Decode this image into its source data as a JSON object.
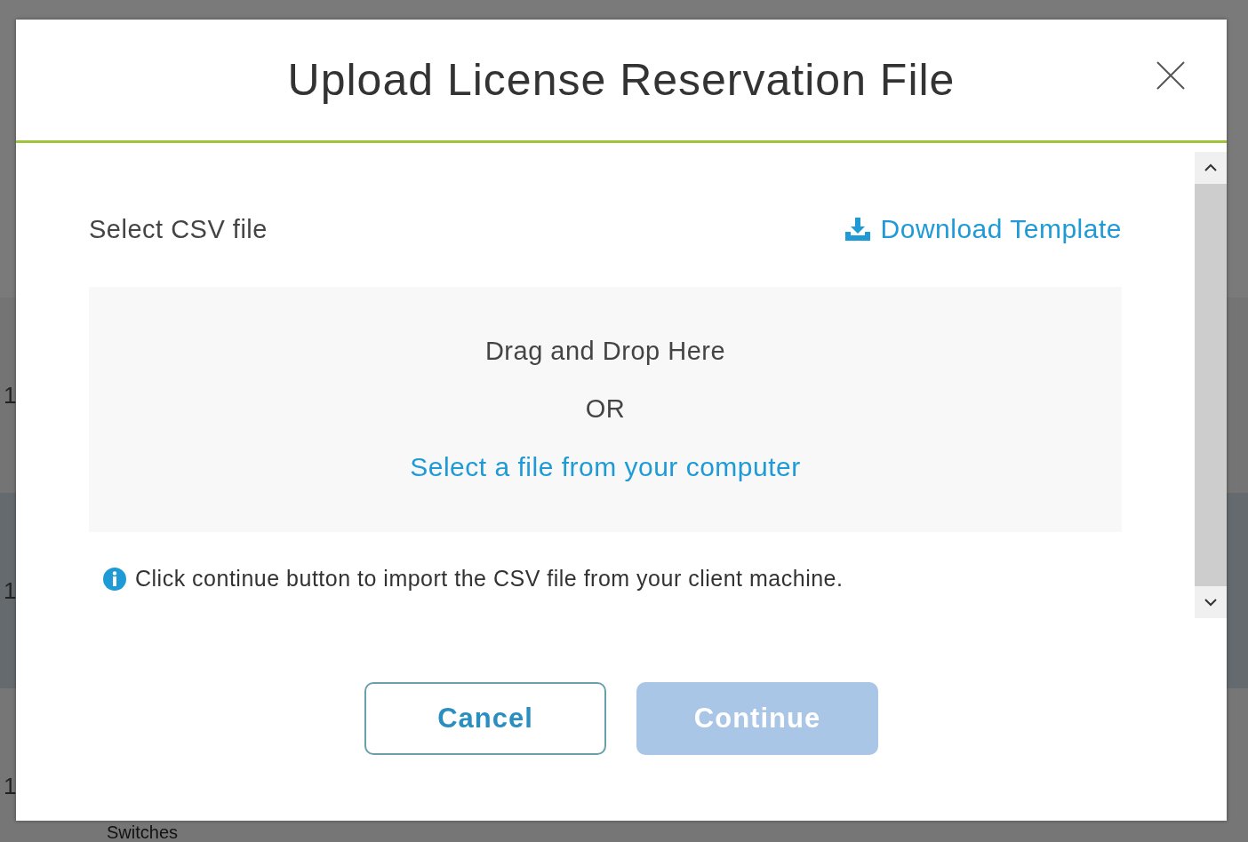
{
  "background": {
    "row_numbers": [
      "1",
      "1",
      "1"
    ],
    "bottom_label": "Switches"
  },
  "dialog": {
    "title": "Upload License Reservation File",
    "section_label": "Select CSV file",
    "download_link": "Download Template",
    "dropzone": {
      "heading": "Drag and Drop Here",
      "separator": "OR",
      "link": "Select a file from your computer"
    },
    "info": "Click continue button to import the CSV file from your client machine.",
    "buttons": [
      {
        "label": "Cancel",
        "kind": "secondary",
        "disabled": false
      },
      {
        "label": "Continue",
        "kind": "primary",
        "disabled": true
      }
    ]
  }
}
